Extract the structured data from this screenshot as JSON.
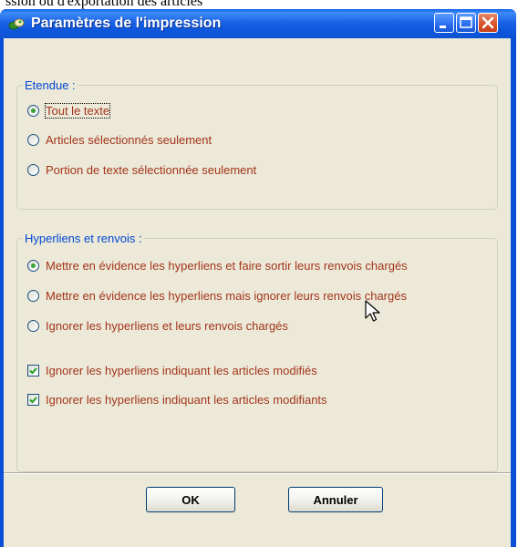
{
  "background": {
    "partial_text": "ssion ou d'exportation des articles"
  },
  "window": {
    "title": "Paramètres de l'impression",
    "controls": [
      "minimize-icon",
      "maximize-icon",
      "close-icon"
    ]
  },
  "extent": {
    "legend": "Etendue :",
    "options": [
      {
        "label": "Tout le texte",
        "checked": true
      },
      {
        "label": "Articles sélectionnés seulement",
        "checked": false
      },
      {
        "label": "Portion de texte sélectionnée seulement",
        "checked": false
      }
    ]
  },
  "hyperlinks": {
    "legend": "Hyperliens et renvois :",
    "options": [
      {
        "label": "Mettre en évidence les hyperliens et faire sortir leurs renvois chargés",
        "checked": true
      },
      {
        "label": "Mettre en évidence les hyperliens mais ignorer leurs renvois chargés",
        "checked": false
      },
      {
        "label": "Ignorer les hyperliens et leurs renvois chargés",
        "checked": false
      }
    ],
    "checkboxes": [
      {
        "label": "Ignorer les hyperliens indiquant les articles modifiés",
        "checked": true
      },
      {
        "label": "Ignorer les hyperliens indiquant les articles modifiants",
        "checked": true
      }
    ]
  },
  "buttons": {
    "ok": "OK",
    "cancel": "Annuler"
  },
  "colors": {
    "title_bar": "#0a4fd8",
    "dialog_bg": "#ece9d8",
    "legend": "#0046d5",
    "option_text": "#a3341b"
  }
}
